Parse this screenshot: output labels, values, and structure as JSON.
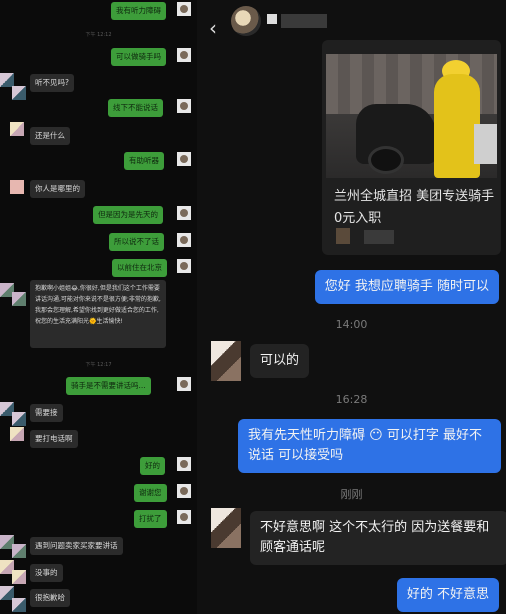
{
  "left_panel": {
    "items": [
      {
        "type": "out",
        "text": "我有听力障碍"
      },
      {
        "type": "time",
        "text": "下午 12:12"
      },
      {
        "type": "out",
        "text": "可以做骑手吗"
      },
      {
        "type": "in",
        "text": "听不见吗?"
      },
      {
        "type": "out",
        "text": "线下不能说话"
      },
      {
        "type": "in",
        "text": "还是什么"
      },
      {
        "type": "out",
        "text": "有助听器"
      },
      {
        "type": "in",
        "text": "你人是哪里的"
      },
      {
        "type": "out",
        "text": "但是因为是先天的"
      },
      {
        "type": "out",
        "text": "所以说不了话"
      },
      {
        "type": "out",
        "text": "以前住在北京"
      },
      {
        "type": "time",
        "text": "下午 12:17"
      },
      {
        "type": "out",
        "text": "骑手是不需要讲话吗..."
      },
      {
        "type": "in",
        "text": "需要接"
      },
      {
        "type": "in",
        "text": "要打电话啊"
      },
      {
        "type": "out",
        "text": "好的"
      },
      {
        "type": "out",
        "text": "谢谢您"
      },
      {
        "type": "out",
        "text": "打扰了"
      },
      {
        "type": "in",
        "text": "遇到问题卖家买家要讲话"
      },
      {
        "type": "in",
        "text": "没事的"
      },
      {
        "type": "in",
        "text": "很抱歉哈"
      }
    ],
    "long_message": "抱歉啊小姐姐😂,你很好,但是我们这个工作需要讲话沟通,可能对你来说不是很方便;非常的抱歉,我那会您理解,希望你找到更好做适合您的工作,祝您的生活充满阳光🌞生活愉快!"
  },
  "header": {
    "back_icon": "‹"
  },
  "card": {
    "title": "兰州全城直招 美团专送骑手 0元入职"
  },
  "messages": {
    "m1": "您好 我想应聘骑手 随时可以",
    "t1": "14:00",
    "m2": "可以的",
    "t2": "16:28",
    "m3": "我有先天性听力障碍 😶 可以打字 最好不说话 可以接受吗",
    "t3": "刚刚",
    "m4": "不好意思啊 这个不太行的 因为送餐要和顾客通话呢",
    "m5": "好的 不好意思"
  },
  "colors": {
    "outgoing_blue": "#2e72e6",
    "outgoing_green": "#3d9d3a",
    "incoming": "#232323"
  }
}
